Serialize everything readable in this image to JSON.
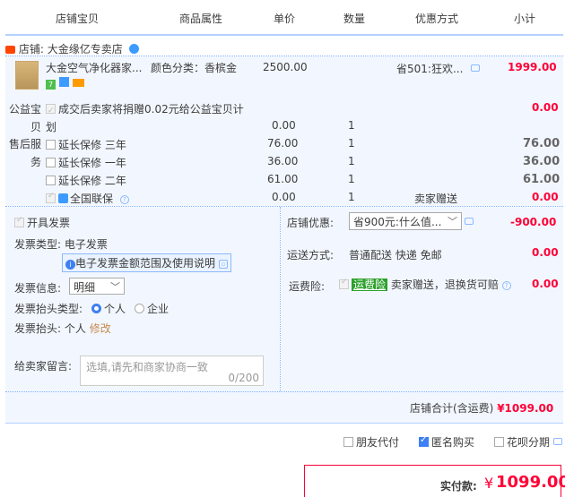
{
  "header": {
    "col_shop_item": "店铺宝贝",
    "col_attrs": "商品属性",
    "col_price": "单价",
    "col_qty": "数量",
    "col_discount": "优惠方式",
    "col_subtotal": "小计"
  },
  "shop": {
    "label": "店铺:",
    "name": "大金缘亿专卖店"
  },
  "item": {
    "title": "大金空气净化器家...",
    "attr": "颜色分类：香槟金",
    "price": "2500.00",
    "discount": "省501:狂欢...",
    "subtotal": "1999.00"
  },
  "charity": {
    "label": "公益宝贝",
    "text": "成交后卖家将捐赠0.02元给公益宝贝计划",
    "price": "0.00",
    "qty": "1",
    "subtotal": "0.00"
  },
  "service": {
    "label": "售后服务",
    "rows": [
      {
        "name": "延长保修 三年",
        "price": "76.00",
        "qty": "1",
        "subtotal": "76.00"
      },
      {
        "name": "延长保修 一年",
        "price": "36.00",
        "qty": "1",
        "subtotal": "36.00"
      },
      {
        "name": "延长保修 二年",
        "price": "61.00",
        "qty": "1",
        "subtotal": "61.00"
      }
    ],
    "warranty": {
      "name": "全国联保",
      "price": "0.00",
      "qty": "1",
      "discount": "卖家赠送",
      "subtotal": "0.00"
    }
  },
  "invoice": {
    "open_label": "开具发票",
    "type_label": "发票类型:",
    "type_value": "电子发票",
    "info_link": "电子发票金额范围及使用说明",
    "detail_label": "发票信息:",
    "detail_value": "明细",
    "head_type_label": "发票抬头类型:",
    "opt_personal": "个人",
    "opt_company": "企业",
    "head_label": "发票抬头:",
    "head_value": "个人",
    "modify": "修改"
  },
  "promo": {
    "shop_discount_label": "店铺优惠:",
    "shop_discount_value": "省900元:什么值...",
    "shop_discount_amount": "-900.00",
    "shipping_label": "运送方式:",
    "shipping_value": "普通配送 快递 免邮",
    "shipping_amount": "0.00",
    "insurance_label": "运费险:",
    "insurance_tag": "运费险",
    "insurance_text": "卖家赠送，退换货可赔",
    "insurance_amount": "0.00"
  },
  "message": {
    "label": "给卖家留言:",
    "placeholder": "选填,请先和商家协商一致",
    "counter": "0/200"
  },
  "total": {
    "label": "店铺合计(含运费)",
    "amount": "¥1099.00"
  },
  "options": {
    "friend_pay": "朋友代付",
    "anonymous": "匿名购买",
    "huabei": "花呗分期"
  },
  "payment": {
    "label": "实付款:",
    "currency": "¥",
    "amount": "1099.00"
  },
  "colors": {
    "accent_red": "#ff0036",
    "accent_blue": "#3d7ff5",
    "panel_bg": "#f2f7ff",
    "header_line": "#b2d1ff"
  }
}
